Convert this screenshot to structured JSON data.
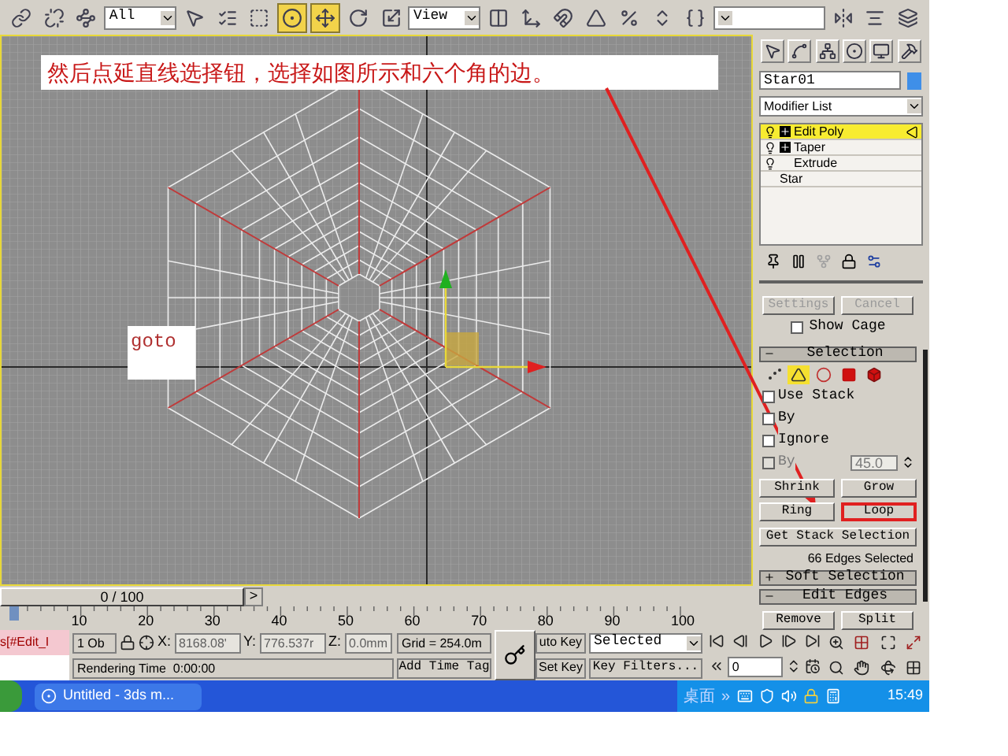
{
  "toolbar": {
    "tools": [
      {
        "kind": "link",
        "selected": false
      },
      {
        "kind": "unlink",
        "selected": false
      },
      {
        "kind": "bind",
        "selected": false
      },
      {
        "kind": "dropdown",
        "value": "All"
      },
      {
        "kind": "select",
        "selected": false
      },
      {
        "kind": "select_by_name",
        "selected": false
      },
      {
        "kind": "region",
        "selected": false
      },
      {
        "kind": "window",
        "selected": true
      },
      {
        "kind": "move",
        "selected": true
      },
      {
        "kind": "rotate",
        "selected": false
      },
      {
        "kind": "scale",
        "selected": false
      },
      {
        "kind": "dropdown",
        "value": "View"
      },
      {
        "kind": "pivot",
        "selected": false
      },
      {
        "kind": "manipulate",
        "selected": false
      },
      {
        "kind": "snap",
        "selected": false
      },
      {
        "kind": "angle_snap",
        "selected": false
      },
      {
        "kind": "percent_snap",
        "selected": false
      },
      {
        "kind": "spinner_snap",
        "selected": false
      },
      {
        "kind": "named_sets",
        "selected": false
      },
      {
        "kind": "named_field"
      },
      {
        "kind": "mirror",
        "selected": false
      },
      {
        "kind": "align",
        "selected": false
      },
      {
        "kind": "layers",
        "selected": false
      }
    ]
  },
  "viewport": {
    "annotation": "然后点延直线选择钮，选择如图所示和六个角的边。",
    "label": "goto"
  },
  "command_panel": {
    "object_name": "Star01",
    "modifier_list": "Modifier List",
    "modifier_stack": [
      {
        "kind": "modifier",
        "label": "Edit Poly",
        "expandable": true,
        "selected": true
      },
      {
        "kind": "modifier",
        "label": "Taper",
        "expandable": true,
        "selected": false
      },
      {
        "kind": "modifier",
        "label": "Extrude",
        "expandable": false,
        "selected": false
      },
      {
        "kind": "base",
        "label": "Star",
        "selected": false
      }
    ],
    "edit_buttons": [
      {
        "label": "Settings",
        "disabled": true
      },
      {
        "label": "Cancel",
        "disabled": true
      }
    ],
    "show_cage": {
      "label": "Show Cage",
      "checked": false
    },
    "selection": {
      "title": "Selection",
      "expanded": true,
      "levels": [
        {
          "kind": "vertex",
          "selected": false
        },
        {
          "kind": "edge",
          "selected": true
        },
        {
          "kind": "border",
          "selected": false
        },
        {
          "kind": "polygon",
          "selected": false
        },
        {
          "kind": "element",
          "selected": false
        }
      ],
      "options": [
        {
          "kind": "checkbox",
          "label": "Use Stack",
          "checked": false,
          "disabled": false
        },
        {
          "kind": "checkbox",
          "label": "By",
          "checked": false,
          "disabled": false
        },
        {
          "kind": "checkbox",
          "label": "Ignore",
          "checked": false,
          "disabled": false
        },
        {
          "kind": "spinner",
          "label": "By",
          "checked": false,
          "disabled": true,
          "value": "45.0"
        }
      ],
      "buttons": [
        {
          "label": "Shrink",
          "highlighted": false
        },
        {
          "label": "Grow",
          "highlighted": false
        },
        {
          "label": "Ring",
          "highlighted": false
        },
        {
          "label": "Loop",
          "highlighted": true
        }
      ],
      "get_stack": "Get Stack Selection",
      "status": "66 Edges Selected"
    },
    "rollouts": [
      {
        "title": "Soft Selection",
        "expanded": false
      },
      {
        "title": "Edit Edges",
        "expanded": true
      }
    ],
    "edit_edges_buttons": [
      "Remove",
      "Split"
    ]
  },
  "time_slider": {
    "label": "0 / 100",
    "button": ">"
  },
  "ruler": {
    "labels": [
      "10",
      "20",
      "30",
      "40",
      "50",
      "60",
      "70",
      "80",
      "90",
      "100"
    ]
  },
  "status_bar": {
    "listener": "s[#Edit_I",
    "selection": "1 Ob",
    "x_label": "X:",
    "x": "8168.08'",
    "y_label": "Y:",
    "y": "776.537r",
    "z_label": "Z:",
    "z": "0.0mm",
    "grid": "Grid = 254.0m",
    "prompt": "Rendering Time  0:00:00",
    "add_time_tag": "Add Time Tag",
    "auto_key": "uto Key",
    "set_key": "Set Key",
    "key_mode": "Selected",
    "key_filters": "Key Filters...",
    "frame": "0"
  },
  "taskbar": {
    "task": "Untitled - 3ds m...",
    "tray_label": "桌面",
    "tray_more": "»",
    "clock": "15:49"
  }
}
